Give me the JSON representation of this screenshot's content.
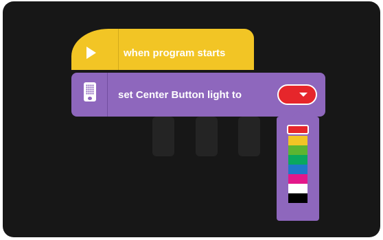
{
  "hat_block": {
    "label": "when program starts",
    "color": "#f2c525",
    "icon": "play-icon"
  },
  "command_block": {
    "label": "set Center Button light to",
    "color": "#8e67bd",
    "icon": "hub-icon",
    "selected_color": "#e6262b"
  },
  "color_palette": {
    "swatches": [
      "#e6262b",
      "#f2c525",
      "#5cb531",
      "#0aa85e",
      "#1f78c8",
      "#e3178a",
      "#ffffff",
      "#000000"
    ],
    "selected_index": 0
  }
}
